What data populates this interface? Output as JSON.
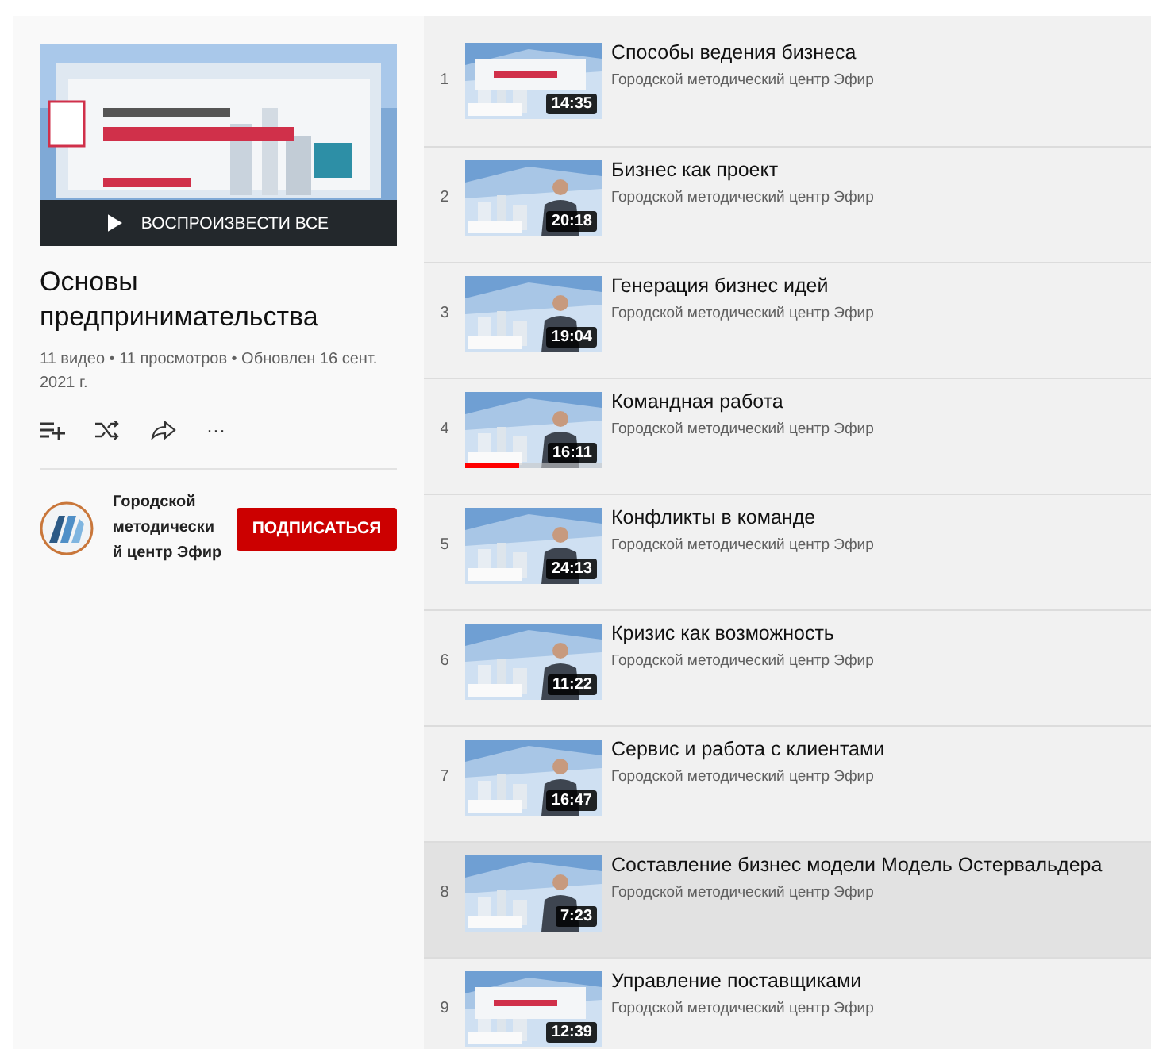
{
  "playlist": {
    "play_all": "ВОСПРОИЗВЕСТИ ВСЕ",
    "title": "Основы предпринимательства",
    "meta": "11 видео • 11 просмотров • Обновлен 16 сент. 2021 г.",
    "more": "···"
  },
  "channel": {
    "name": "Городской методически й центр Эфир",
    "subscribe": "ПОДПИСАТЬСЯ"
  },
  "videos": [
    {
      "index": "1",
      "title": "Способы ведения бизнеса",
      "channel": "Городской методический центр Эфир",
      "duration": "14:35",
      "selected": false
    },
    {
      "index": "2",
      "title": "Бизнес как проект",
      "channel": "Городской методический центр Эфир",
      "duration": "20:18",
      "selected": false
    },
    {
      "index": "3",
      "title": "Генерация бизнес идей",
      "channel": "Городской методический центр Эфир",
      "duration": "19:04",
      "selected": false
    },
    {
      "index": "4",
      "title": "Командная работа",
      "channel": "Городской методический центр Эфир",
      "duration": "16:11",
      "selected": false,
      "level": 0.4
    },
    {
      "index": "5",
      "title": "Конфликты в команде",
      "channel": "Городской методический центр Эфир",
      "duration": "24:13",
      "selected": false
    },
    {
      "index": "6",
      "title": "Кризис как возможность",
      "channel": "Городской методический центр Эфир",
      "duration": "11:22",
      "selected": false
    },
    {
      "index": "7",
      "title": "Сервис и работа с клиентами",
      "channel": "Городской методический центр Эфир",
      "duration": "16:47",
      "selected": false
    },
    {
      "index": "8",
      "title": "Составление бизнес модели Модель Остервальдера",
      "channel": "Городской методический центр Эфир",
      "duration": "7:23",
      "selected": true
    },
    {
      "index": "9",
      "title": "Управление поставщиками",
      "channel": "Городской методический центр Эфир",
      "duration": "12:39",
      "selected": false
    }
  ]
}
